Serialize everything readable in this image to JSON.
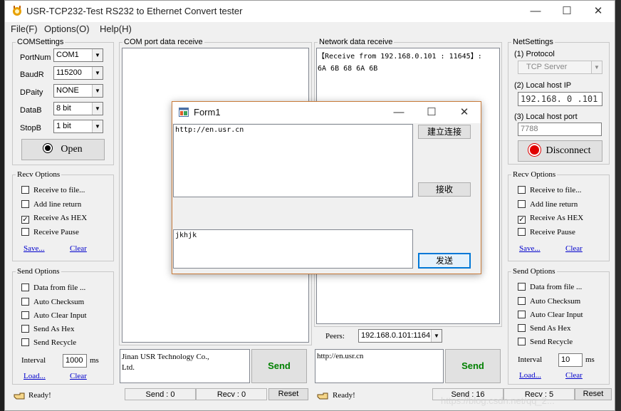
{
  "window": {
    "title": "USR-TCP232-Test  RS232 to Ethernet Convert tester",
    "controls": {
      "minimize": "—",
      "maximize": "☐",
      "close": "✕"
    }
  },
  "menu": [
    "File(F)",
    "Options(O)",
    "Help(H)"
  ],
  "com_settings": {
    "legend": "COMSettings",
    "fields": [
      {
        "label": "PortNum",
        "value": "COM1"
      },
      {
        "label": "BaudR",
        "value": "115200"
      },
      {
        "label": "DPaity",
        "value": "NONE"
      },
      {
        "label": "DataB",
        "value": "8 bit"
      },
      {
        "label": "StopB",
        "value": "1 bit"
      }
    ],
    "open_button": "Open"
  },
  "left_recv_options": {
    "legend": "Recv Options",
    "items": [
      {
        "label": "Receive to file...",
        "checked": false
      },
      {
        "label": "Add line return",
        "checked": false
      },
      {
        "label": "Receive As HEX",
        "checked": true
      },
      {
        "label": "Receive Pause",
        "checked": false
      }
    ],
    "save": "Save...",
    "clear": "Clear"
  },
  "left_send_options": {
    "legend": "Send Options",
    "items": [
      {
        "label": "Data from file ...",
        "checked": false
      },
      {
        "label": "Auto Checksum",
        "checked": false
      },
      {
        "label": "Auto Clear Input",
        "checked": false
      },
      {
        "label": "Send As Hex",
        "checked": false
      },
      {
        "label": "Send Recycle",
        "checked": false
      }
    ],
    "interval_label": "Interval",
    "interval_value": "1000",
    "interval_unit": "ms",
    "load": "Load...",
    "clear": "Clear"
  },
  "com_receive": {
    "legend": "COM port data receive",
    "text": ""
  },
  "com_send": {
    "text_line1": "Jinan USR Technology Co.,",
    "text_line2": "Ltd.",
    "send_button": "Send"
  },
  "net_receive": {
    "legend": "Network data receive",
    "line1": "【Receive from 192.168.0.101 : 11645】:",
    "line2": "6A 6B 68 6A 6B"
  },
  "peers": {
    "label": "Peers:",
    "value": "192.168.0.101:1164"
  },
  "net_send": {
    "text": "http://en.usr.cn",
    "send_button": "Send"
  },
  "net_settings": {
    "legend": "NetSettings",
    "protocol_label": "(1) Protocol",
    "protocol_value": "TCP Server",
    "ip_label": "(2) Local host IP",
    "ip_value": "192.168. 0 .101",
    "port_label": "(3) Local host port",
    "port_value": "7788",
    "disconnect_button": "Disconnect"
  },
  "right_recv_options": {
    "legend": "Recv Options",
    "items": [
      {
        "label": "Receive to file...",
        "checked": false
      },
      {
        "label": "Add line return",
        "checked": false
      },
      {
        "label": "Receive As HEX",
        "checked": true
      },
      {
        "label": "Receive Pause",
        "checked": false
      }
    ],
    "save": "Save...",
    "clear": "Clear"
  },
  "right_send_options": {
    "legend": "Send Options",
    "items": [
      {
        "label": "Data from file ...",
        "checked": false
      },
      {
        "label": "Auto Checksum",
        "checked": false
      },
      {
        "label": "Auto Clear Input",
        "checked": false
      },
      {
        "label": "Send As Hex",
        "checked": false
      },
      {
        "label": "Send Recycle",
        "checked": false
      }
    ],
    "interval_label": "Interval",
    "interval_value": "10",
    "interval_unit": "ms",
    "load": "Load...",
    "clear": "Clear"
  },
  "status_left": {
    "ready": "Ready!",
    "send": "Send : 0",
    "recv": "Recv : 0",
    "reset": "Reset"
  },
  "status_right": {
    "ready": "Ready!",
    "send": "Send : 16",
    "recv": "Recv : 5",
    "reset": "Reset"
  },
  "watermark": "https://blog.csdn.net/qq_2...",
  "form1": {
    "title": "Form1",
    "top_text": "http://en.usr.cn",
    "bottom_text": "jkhjk",
    "connect_button": "建立连接",
    "receive_button": "接收",
    "send_button": "发送",
    "controls": {
      "minimize": "—",
      "maximize": "☐",
      "close": "✕"
    }
  },
  "colors": {
    "accent_focus": "#0078d7",
    "send_green": "#008000",
    "record_red": "#e00000"
  }
}
